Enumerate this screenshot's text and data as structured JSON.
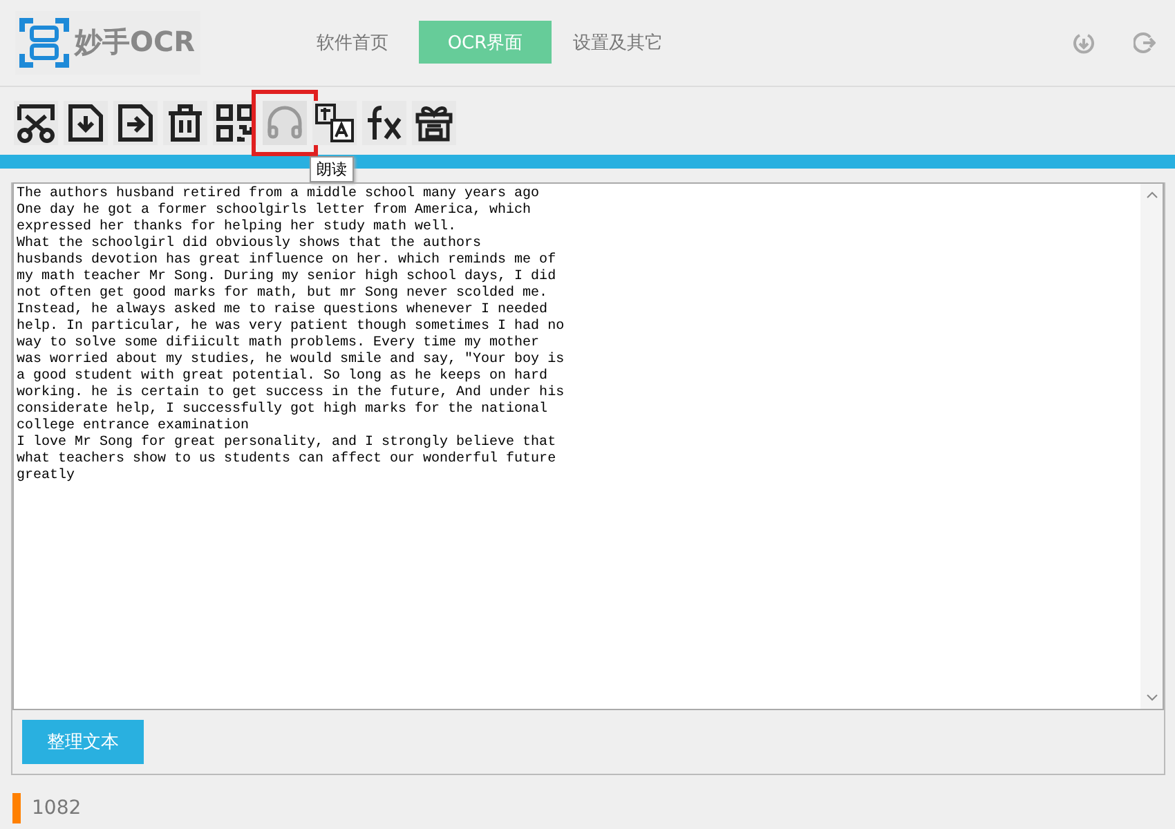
{
  "app": {
    "logo_text": "妙手OCR"
  },
  "nav_tabs": [
    {
      "label": "软件首页",
      "selected": false
    },
    {
      "label": "OCR界面",
      "selected": true
    },
    {
      "label": "设置及其它",
      "selected": false
    }
  ],
  "toolbar": [
    {
      "kind": "cut",
      "highlighted": false
    },
    {
      "kind": "import",
      "highlighted": false
    },
    {
      "kind": "export",
      "highlighted": false
    },
    {
      "kind": "delete",
      "highlighted": false
    },
    {
      "kind": "qr",
      "highlighted": false
    },
    {
      "kind": "read",
      "highlighted": true,
      "tooltip": "朗读"
    },
    {
      "kind": "translate",
      "highlighted": false
    },
    {
      "kind": "formula",
      "highlighted": false
    },
    {
      "kind": "reward",
      "highlighted": false
    }
  ],
  "text_area": {
    "lines": [
      "The authors husband retired from a middle school many years ago",
      "One day he got a former schoolgirls letter from America, which",
      "expressed her thanks for helping her study math well.",
      "What the schoolgirl did obviously shows that the authors",
      "husbands devotion has great influence on her. which reminds me of",
      "my math teacher Mr Song. During my senior high school days, I did",
      "not often get good marks for math, but mr Song never scolded me.",
      "Instead, he always asked me to raise questions whenever I needed",
      "help. In particular, he was very patient though sometimes I had no",
      "way to solve some difiicult math problems. Every time my mother",
      "was worried about my studies, he would smile and say, \"Your boy is",
      "a good student with great potential. So long as he keeps on hard",
      "working. he is certain to get success in the future, And under his",
      "considerate help, I successfully got high marks for the national",
      "college entrance examination",
      "I love Mr Song for great personality, and I strongly believe that",
      "what teachers show to us students can affect our wonderful future",
      "greatly"
    ]
  },
  "action_button": "整理文本",
  "status_bar": {
    "count": "1082"
  }
}
